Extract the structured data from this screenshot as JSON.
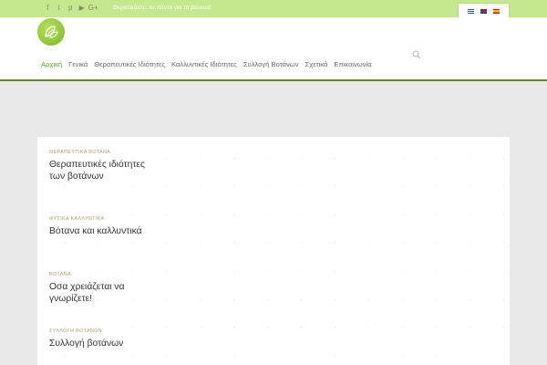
{
  "topbar": {
    "social": [
      {
        "icon": "facebook-icon",
        "glyph": "f"
      },
      {
        "icon": "twitter-icon",
        "glyph": "t"
      },
      {
        "icon": "pinterest-icon",
        "glyph": "p"
      },
      {
        "icon": "youtube-icon",
        "glyph": "▶"
      },
      {
        "icon": "google-plus-icon",
        "glyph": "G+"
      }
    ],
    "tagline": "Θεραπεύστε, τα πάντα για τα βότανα!",
    "languages": [
      "Ελληνικά",
      "English",
      "Español"
    ]
  },
  "colors": {
    "accent": "#5f9a19",
    "topbar": "#c3e88d",
    "navline": "#5a8a2a"
  },
  "nav": {
    "items": [
      "Αρχική",
      "Γενικά",
      "Θεραπευτικές Ιδιότητες",
      "Καλλυντικές Ιδιότητες",
      "Συλλογή Βοτάνων",
      "Σχετικά",
      "Επικοινωνία"
    ]
  },
  "posts": [
    {
      "category": "ΘΕΡΑΠΕΥΤΙΚΑ ΒΟΤΑΝΑ",
      "title": "Θεραπευτικές ιδιότητες των βοτάνων"
    },
    {
      "category": "ΦΥΣΙΚΑ ΚΑΛΛΥΝΤΙΚΑ",
      "title": "Βότανα και καλλυντικά"
    },
    {
      "category": "ΒΟΤΑΝΑ",
      "title": "Οσα χρειάζεται να γνωρίζετε!"
    },
    {
      "category": "ΣΥΛΛΟΓΗ ΒΟΤΑΝΩΝ",
      "title": "Συλλογή βοτάνων"
    }
  ]
}
